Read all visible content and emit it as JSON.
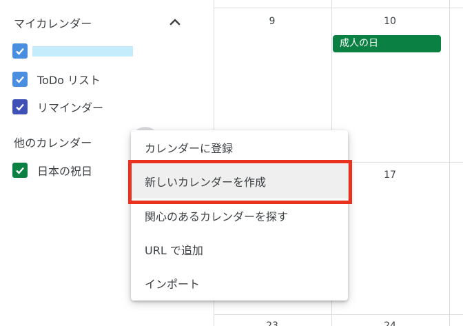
{
  "sidebar": {
    "my_calendars": {
      "title": "マイカレンダー",
      "items": [
        {
          "label": "",
          "color": "#4a8ee0"
        },
        {
          "label": "ToDo リスト",
          "color": "#4a8ee0"
        },
        {
          "label": "リマインダー",
          "color": "#3f51b5"
        }
      ]
    },
    "other_calendars": {
      "title": "他のカレンダー",
      "items": [
        {
          "label": "日本の祝日",
          "color": "#0b8043"
        }
      ]
    }
  },
  "calendar": {
    "days": [
      "9",
      "10",
      "17",
      "23",
      "24"
    ],
    "events": [
      {
        "title": "成人の日",
        "color": "#0b8043"
      }
    ]
  },
  "context_menu": {
    "items": [
      "カレンダーに登録",
      "新しいカレンダーを作成",
      "関心のあるカレンダーを探す",
      "URL で追加",
      "インポート"
    ],
    "highlighted_index": 1,
    "highlight_color": "#e8311f"
  },
  "icons": {
    "collapse": "chevron-up-icon",
    "checkbox": "check-icon"
  }
}
